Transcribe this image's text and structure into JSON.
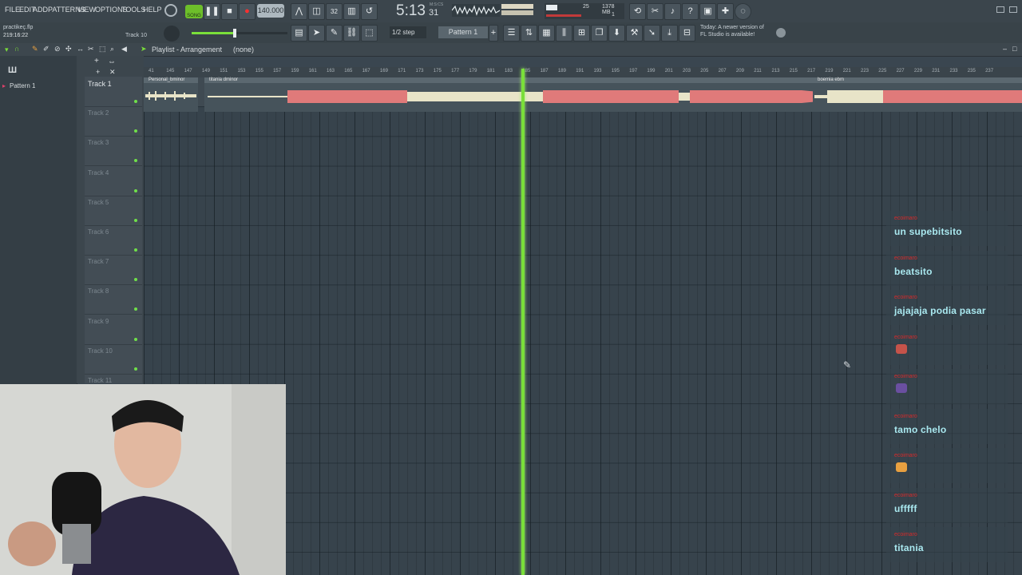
{
  "menu": [
    "FILE",
    "EDIT",
    "ADD",
    "PATTERNS",
    "VIEW",
    "OPTIONS",
    "TOOLS",
    "HELP"
  ],
  "transport": {
    "song_label": "SONG",
    "tempo": "140.000",
    "time": "5:13",
    "time_small": "31",
    "time_unit": "M:S:CS"
  },
  "monitor": {
    "cpu_value": "25",
    "memory": "1378 MB",
    "poly": "1"
  },
  "project": {
    "file": "practikeç.flp",
    "position": "219:16:22",
    "track": "Track 10"
  },
  "toolbar2": {
    "step": "1/2 step",
    "pattern": "Pattern 1"
  },
  "news": {
    "line1": "Today: A newer version of",
    "line2": "FL Studio is available!"
  },
  "playlist": {
    "title": "Playlist - Arrangement",
    "sub": "(none)"
  },
  "pattern_list": [
    "Pattern 1"
  ],
  "tracks": [
    "Track 1",
    "Track 2",
    "Track 3",
    "Track 4",
    "Track 5",
    "Track 6",
    "Track 7",
    "Track 8",
    "Track 9",
    "Track 10",
    "Track 11"
  ],
  "ruler_ticks": [
    "41",
    "145",
    "147",
    "149",
    "151",
    "153",
    "155",
    "157",
    "159",
    "161",
    "163",
    "165",
    "167",
    "169",
    "171",
    "173",
    "175",
    "177",
    "179",
    "181",
    "183",
    "185",
    "187",
    "189",
    "191",
    "193",
    "195",
    "197",
    "199",
    "201",
    "203",
    "205",
    "207",
    "209",
    "211",
    "213",
    "215",
    "217",
    "219",
    "221",
    "223",
    "225",
    "227",
    "229",
    "231",
    "233",
    "235",
    "237"
  ],
  "clips": [
    {
      "label": "Personal_bminor"
    },
    {
      "label": "titania dminor"
    },
    {
      "label": "boemia ebm"
    }
  ],
  "chat": [
    {
      "user": "ecoimaro",
      "text": "un supebitsito"
    },
    {
      "user": "ecoimaro",
      "text": "beatsito"
    },
    {
      "user": "ecoimaro",
      "text": "jajajaja podia pasar"
    },
    {
      "user": "ecoimaro",
      "text": "",
      "emoji": "emoji-1"
    },
    {
      "user": "ecoimaro",
      "text": "",
      "emoji": "emoji-2"
    },
    {
      "user": "ecoimaro",
      "text": "tamo chelo"
    },
    {
      "user": "ecoimaro",
      "text": "",
      "emoji": "emoji-3"
    },
    {
      "user": "ecoimaro",
      "text": "ufffff"
    },
    {
      "user": "ecoimaro",
      "text": "titania"
    }
  ],
  "colors": {
    "accent_green": "#7adf3a",
    "chat_text": "#a9e8ef",
    "chat_user": "#d42a2a"
  }
}
